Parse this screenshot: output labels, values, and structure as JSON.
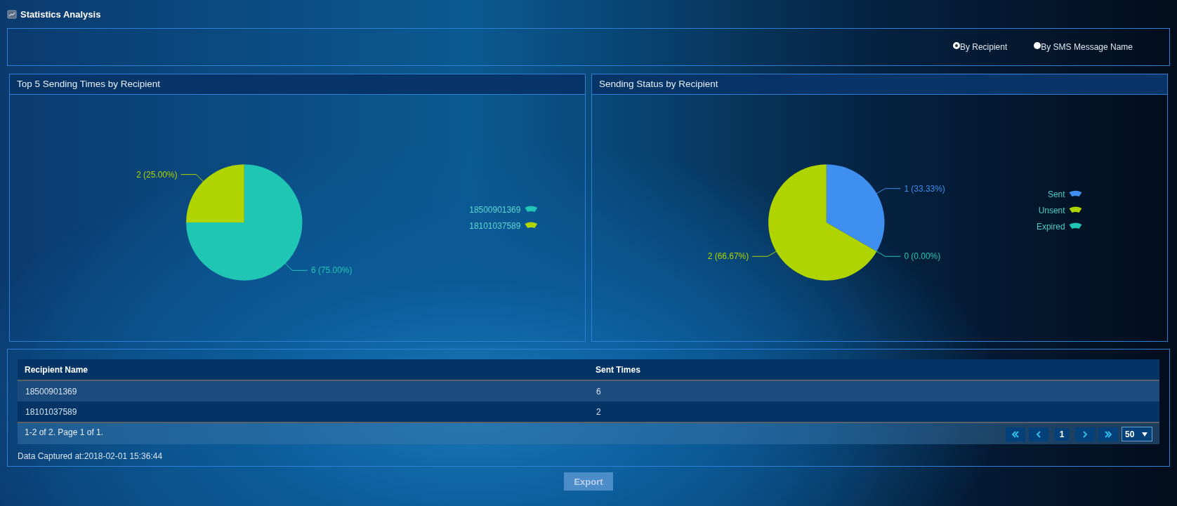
{
  "page": {
    "title": "Statistics Analysis"
  },
  "filter": {
    "options": [
      {
        "label": "By Recipient",
        "selected": true
      },
      {
        "label": "By SMS Message Name",
        "selected": false
      }
    ]
  },
  "charts": [
    {
      "title": "Top 5 Sending Times by Recipient",
      "chart_data": {
        "type": "pie",
        "categories": [
          "18500901369",
          "18101037589"
        ],
        "values": [
          6,
          2
        ],
        "colors": [
          "#1fc6b4",
          "#b0d400"
        ],
        "data_labels": true,
        "value_labels": [
          "6 (75.00%)",
          "2 (25.00%)"
        ],
        "legend": "right"
      }
    },
    {
      "title": "Sending Status by Recipient",
      "chart_data": {
        "type": "pie",
        "categories": [
          "Sent",
          "Unsent",
          "Expired"
        ],
        "values": [
          1,
          2,
          0
        ],
        "colors": [
          "#3e8fef",
          "#b0d400",
          "#1fc6b4"
        ],
        "data_labels": true,
        "value_labels": [
          "1 (33.33%)",
          "2 (66.67%)",
          "0 (0.00%)"
        ],
        "legend": "right"
      }
    }
  ],
  "table": {
    "columns": [
      "Recipient Name",
      "Sent Times"
    ],
    "rows": [
      [
        "18500901369",
        "6"
      ],
      [
        "18101037589",
        "2"
      ]
    ],
    "summary": "1-2 of 2. Page 1 of 1.",
    "current_page": "1",
    "page_size": "50"
  },
  "captured": "Data Captured at:2018-02-01 15:36:44",
  "export_button": "Export"
}
